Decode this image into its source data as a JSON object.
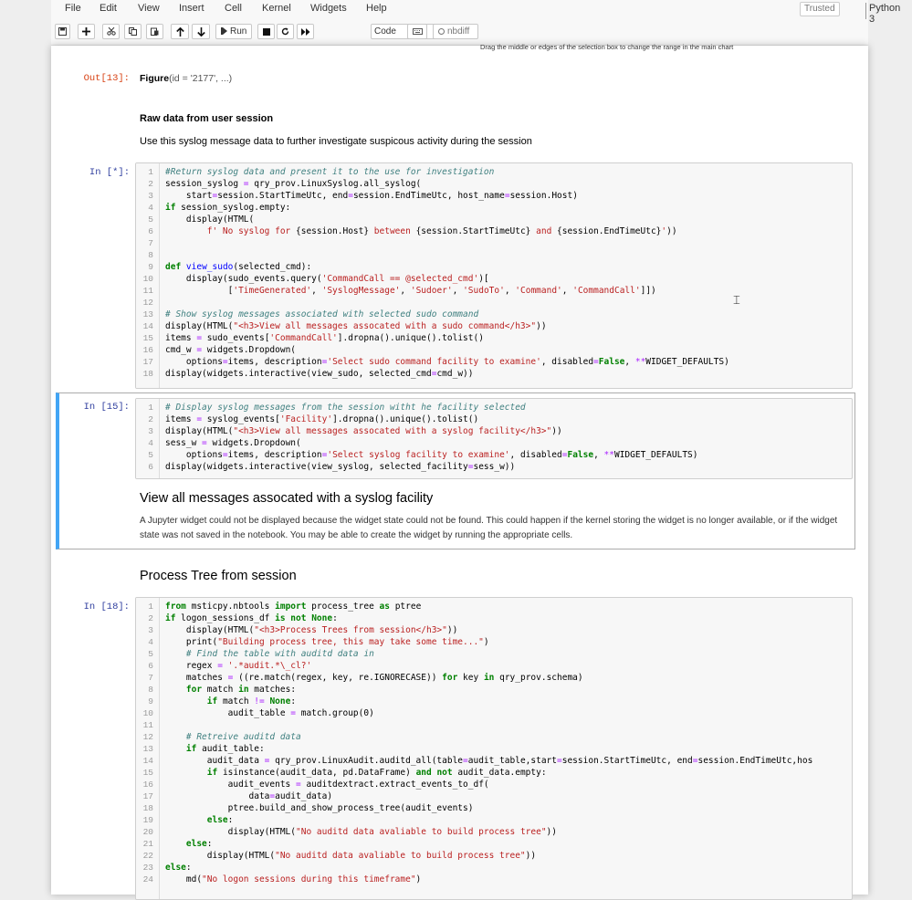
{
  "menubar": {
    "items": [
      "File",
      "Edit",
      "View",
      "Insert",
      "Cell",
      "Kernel",
      "Widgets",
      "Help"
    ],
    "trusted": "Trusted",
    "kernel": "Python 3"
  },
  "toolbar": {
    "buttons": [
      "save-icon",
      "plus-icon",
      "cut-icon",
      "copy-icon",
      "paste-icon",
      "arrow-up-icon",
      "arrow-down-icon",
      "step-forward-icon",
      "stop-icon",
      "restart-icon",
      "fast-forward-icon",
      "keyboard-icon",
      "history-icon"
    ],
    "run_label": "Run",
    "cell_type": "Code",
    "nbdiff_label": "nbdiff"
  },
  "notebook": {
    "chart_hint": "Drag the middle or edges of the selection box to change the range in the main chart",
    "out13": {
      "prompt": "Out[13]:",
      "figure_name": "Figure",
      "figure_args": "(id = '2177', ...)"
    },
    "raw_heading": "Raw data from user session",
    "raw_text": "Use this syslog message data to further investigate suspicous activity during the session",
    "cell1_prompt": "In [*]:",
    "cell2_prompt": "In [15]:",
    "syslog_heading": "View all messages assocated with a syslog facility",
    "widget_error": "A Jupyter widget could not be displayed because the widget state could not be found. This could happen if the kernel storing the widget is no longer available, or if the widget state was not saved in the notebook. You may be able to create the widget by running the appropriate cells.",
    "process_heading": "Process Tree from session",
    "cell3_prompt": "In [18]:"
  },
  "cells": {
    "cell1": [
      "<span class=\"c\">#Return syslog data and present it to the use for investigation</span>",
      "session_syslog <span class=\"o\">=</span> qry_prov.LinuxSyslog.all_syslog(",
      "    start<span class=\"o\">=</span>session.StartTimeUtc, end<span class=\"o\">=</span>session.EndTimeUtc, host_name<span class=\"o\">=</span>session.Host)",
      "<span class=\"k\">if</span> session_syslog.empty:",
      "    display(HTML(",
      "        <span class=\"s\">f' No syslog for </span>{session.Host}<span class=\"s\"> between </span>{session.StartTimeUtc}<span class=\"s\"> and </span>{session.EndTimeUtc}<span class=\"s\">'</span>))",
      "",
      "",
      "<span class=\"k\">def</span> <span class=\"f\">view_sudo</span>(selected_cmd):",
      "    display(sudo_events.query(<span class=\"s\">'CommandCall == @selected_cmd'</span>)[",
      "            [<span class=\"s\">'TimeGenerated'</span>, <span class=\"s\">'SyslogMessage'</span>, <span class=\"s\">'Sudoer'</span>, <span class=\"s\">'SudoTo'</span>, <span class=\"s\">'Command'</span>, <span class=\"s\">'CommandCall'</span>]])",
      "",
      "<span class=\"c\"># Show syslog messages associated with selected sudo command</span>",
      "display(HTML(<span class=\"s\">\"&lt;h3&gt;View all messages assocated with a sudo command&lt;/h3&gt;\"</span>))",
      "items <span class=\"o\">=</span> sudo_events[<span class=\"s\">'CommandCall'</span>].dropna().unique().tolist()",
      "cmd_w <span class=\"o\">=</span> widgets.Dropdown(",
      "    options<span class=\"o\">=</span>items, description<span class=\"o\">=</span><span class=\"s\">'Select sudo command facility to examine'</span>, disabled<span class=\"o\">=</span><span class=\"k\">False</span>, <span class=\"o\">**</span>WIDGET_DEFAULTS)",
      "display(widgets.interactive(view_sudo, selected_cmd<span class=\"o\">=</span>cmd_w))"
    ],
    "cell2": [
      "<span class=\"c\"># Display syslog messages from the session witht he facility selected</span>",
      "items <span class=\"o\">=</span> syslog_events[<span class=\"s\">'Facility'</span>].dropna().unique().tolist()",
      "display(HTML(<span class=\"s\">\"&lt;h3&gt;View all messages assocated with a syslog facility&lt;/h3&gt;\"</span>))",
      "sess_w <span class=\"o\">=</span> widgets.Dropdown(",
      "    options<span class=\"o\">=</span>items, description<span class=\"o\">=</span><span class=\"s\">'Select syslog facility to examine'</span>, disabled<span class=\"o\">=</span><span class=\"k\">False</span>, <span class=\"o\">**</span>WIDGET_DEFAULTS)",
      "display(widgets.interactive(view_syslog, selected_facility<span class=\"o\">=</span>sess_w))"
    ],
    "cell3": [
      "<span class=\"k\">from</span> msticpy.nbtools <span class=\"k\">import</span> process_tree <span class=\"k\">as</span> ptree",
      "<span class=\"k\">if</span> logon_sessions_df <span class=\"k\">is not</span> <span class=\"k\">None</span>:",
      "    display(HTML(<span class=\"s\">\"&lt;h3&gt;Process Trees from session&lt;/h3&gt;\"</span>))",
      "    print(<span class=\"s\">\"Building process tree, this may take some time...\"</span>)",
      "    <span class=\"c\"># Find the table with auditd data in</span>",
      "    regex <span class=\"o\">=</span> <span class=\"s\">'.*audit.*\\_cl?'</span>",
      "    matches <span class=\"o\">=</span> ((re.match(regex, key, re.IGNORECASE)) <span class=\"k\">for</span> key <span class=\"k\">in</span> qry_prov.schema)",
      "    <span class=\"k\">for</span> match <span class=\"k\">in</span> matches:",
      "        <span class=\"k\">if</span> match <span class=\"o\">!=</span> <span class=\"k\">None</span>:",
      "            audit_table <span class=\"o\">=</span> match.group(0)",
      "",
      "    <span class=\"c\"># Retreive auditd data</span>",
      "    <span class=\"k\">if</span> audit_table:",
      "        audit_data <span class=\"o\">=</span> qry_prov.LinuxAudit.auditd_all(table<span class=\"o\">=</span>audit_table,start<span class=\"o\">=</span>session.StartTimeUtc, end<span class=\"o\">=</span>session.EndTimeUtc,hos",
      "        <span class=\"k\">if</span> isinstance(audit_data, pd.DataFrame) <span class=\"k\">and not</span> audit_data.empty:",
      "            audit_events <span class=\"o\">=</span> auditdextract.extract_events_to_df(",
      "                data<span class=\"o\">=</span>audit_data)",
      "            ptree.build_and_show_process_tree(audit_events)",
      "        <span class=\"k\">else</span>:",
      "            display(HTML(<span class=\"s\">\"No auditd data avaliable to build process tree\"</span>))",
      "    <span class=\"k\">else</span>:",
      "        display(HTML(<span class=\"s\">\"No auditd data avaliable to build process tree\"</span>))",
      "<span class=\"k\">else</span>:",
      "    md(<span class=\"s\">\"No logon sessions during this timeframe\"</span>)"
    ]
  },
  "colors": {
    "selected_cell_bar": "#42a5f5",
    "in_prompt": "#303f9f",
    "out_prompt": "#d84315"
  }
}
